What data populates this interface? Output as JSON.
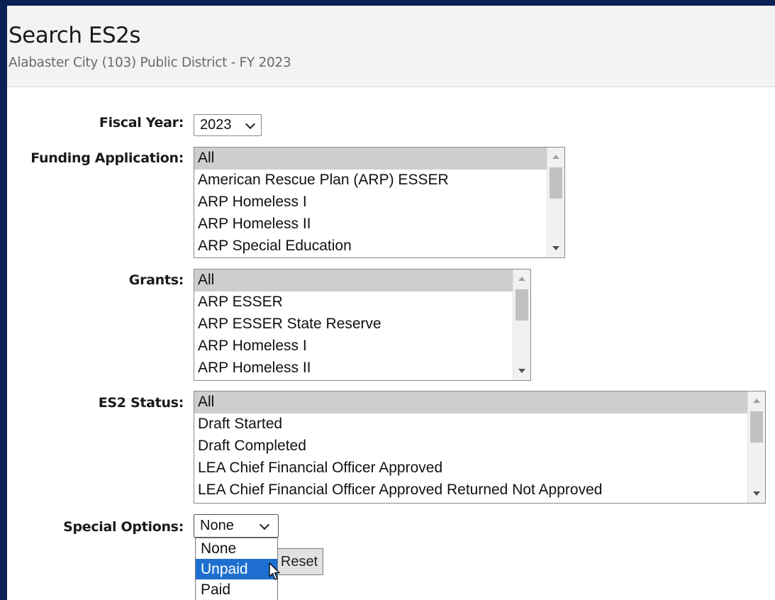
{
  "header": {
    "title": "Search ES2s",
    "subtitle": "Alabaster City (103) Public District - FY 2023"
  },
  "form": {
    "fiscal_year": {
      "label": "Fiscal Year:",
      "value": "2023"
    },
    "funding_application": {
      "label": "Funding Application:",
      "options": [
        "All",
        "American Rescue Plan (ARP) ESSER",
        "ARP Homeless I",
        "ARP Homeless II",
        "ARP Special Education"
      ],
      "selected": "All"
    },
    "grants": {
      "label": "Grants:",
      "options": [
        "All",
        "ARP ESSER",
        "ARP ESSER State Reserve",
        "ARP Homeless I",
        "ARP Homeless II"
      ],
      "selected": "All"
    },
    "es2_status": {
      "label": "ES2 Status:",
      "options": [
        "All",
        "Draft Started",
        "Draft Completed",
        "LEA Chief Financial Officer Approved",
        "LEA Chief Financial Officer Approved Returned Not Approved"
      ],
      "selected": "All"
    },
    "special_options": {
      "label": "Special Options:",
      "value": "None",
      "open_options": [
        "None",
        "Unpaid",
        "Paid"
      ],
      "highlighted": "Unpaid"
    },
    "reset_label": "Reset"
  },
  "colors": {
    "frame_background": "#0a2156",
    "header_background": "#f3f3f5",
    "selected_option": "#cecece",
    "highlight_option": "#1e6fd0"
  },
  "icons": {
    "dropdown": "chevron-down-icon",
    "scroll_up": "scroll-up-arrow-icon",
    "scroll_down": "scroll-down-arrow-icon",
    "pointer": "mouse-pointer-icon"
  }
}
